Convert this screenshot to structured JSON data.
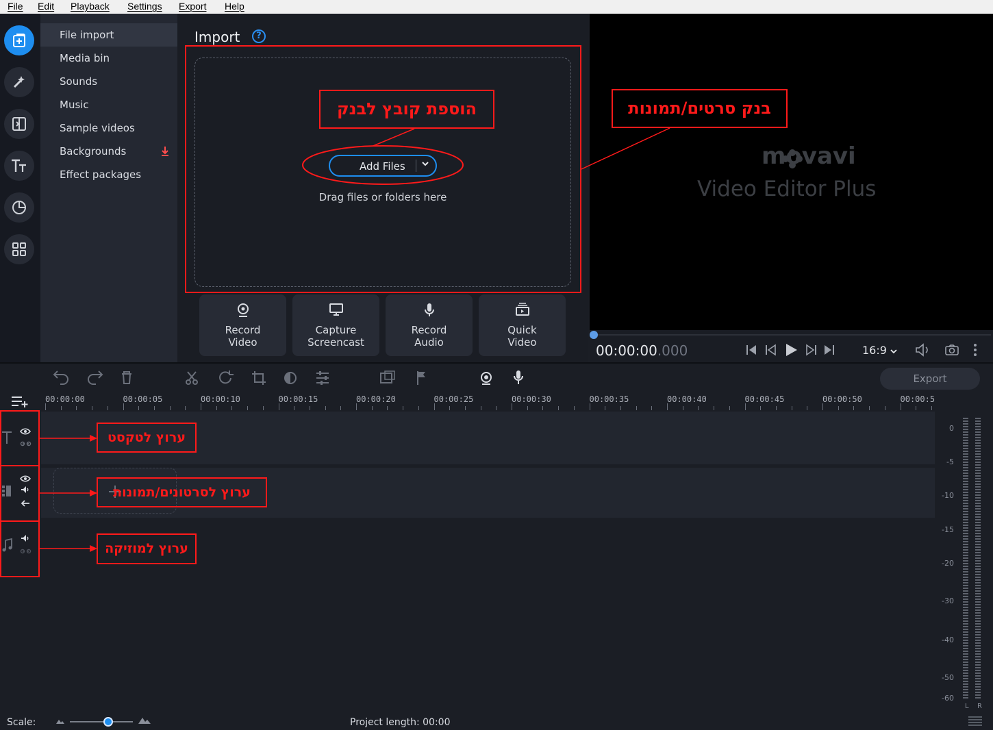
{
  "menu": {
    "file": "File",
    "edit": "Edit",
    "playback": "Playback",
    "settings": "Settings",
    "export": "Export",
    "help": "Help"
  },
  "rail_icons": [
    "import-icon",
    "magic-wand-icon",
    "transitions-icon",
    "titles-icon",
    "stickers-icon",
    "more-tools-icon"
  ],
  "sidebar": {
    "items": [
      {
        "label": "File import",
        "active": true
      },
      {
        "label": "Media bin"
      },
      {
        "label": "Sounds"
      },
      {
        "label": "Music"
      },
      {
        "label": "Sample videos"
      },
      {
        "label": "Backgrounds",
        "badge_icon": "download-icon"
      },
      {
        "label": "Effect packages"
      }
    ]
  },
  "import": {
    "title": "Import",
    "help": "?",
    "add_files": "Add Files",
    "drag_hint": "Drag files or folders here"
  },
  "capture_buttons": [
    {
      "line1": "Record",
      "line2": "Video",
      "icon": "webcam-icon"
    },
    {
      "line1": "Capture",
      "line2": "Screencast",
      "icon": "monitor-icon"
    },
    {
      "line1": "Record",
      "line2": "Audio",
      "icon": "microphone-icon"
    },
    {
      "line1": "Quick",
      "line2": "Video",
      "icon": "quick-video-icon"
    }
  ],
  "preview": {
    "brand": "movavi",
    "product": "Video Editor Plus",
    "timecode_main": "00:00:00",
    "timecode_ms": ".000",
    "aspect": "16:9"
  },
  "timeline": {
    "export_label": "Export",
    "ruler": [
      "00:00:00",
      "00:00:05",
      "00:00:10",
      "00:00:15",
      "00:00:20",
      "00:00:25",
      "00:00:30",
      "00:00:35",
      "00:00:40",
      "00:00:45",
      "00:00:50",
      "00:00:5"
    ]
  },
  "meter": {
    "labels": [
      "0",
      "-5",
      "-10",
      "-15",
      "-20",
      "-30",
      "-40",
      "-50",
      "-60"
    ],
    "left": "L",
    "right": "R"
  },
  "bottom": {
    "scale_label": "Scale:",
    "project_length": "Project length:  00:00"
  },
  "annotations": {
    "add_file": "הוספת קובץ לבנק",
    "media_bank": "בנק סרטים/תמונות",
    "text_track": "ערוץ לטקסט",
    "video_track": "ערוץ לסרטונים/תמונות",
    "music_track": "ערוץ למוזיקה",
    "color": "#ff1a1a"
  },
  "colors": {
    "accent": "#1e8ef0",
    "background": "#1b1e25"
  }
}
